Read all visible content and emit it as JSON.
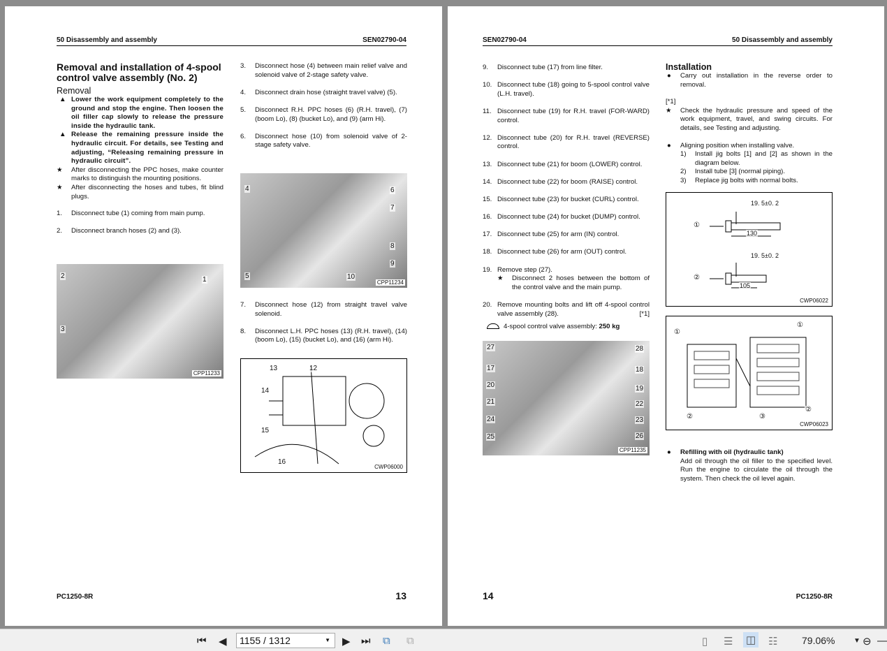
{
  "left_page": {
    "header_left": "50 Disassembly and assembly",
    "header_right": "SEN02790-04",
    "title": "Removal and installation of 4-spool control valve assembly (No. 2)",
    "section": "Removal",
    "warnings": [
      "Lower the work equipment completely to the ground and stop the engine. Then loosen the oil filler cap slowly to release the pressure inside the hydraulic tank.",
      "Release the remaining pressure inside the hydraulic circuit. For details, see Testing and adjusting, “Releasing remaining pressure in hydraulic circuit”."
    ],
    "notes": [
      "After disconnecting the PPC hoses, make counter marks to distinguish the mounting positions.",
      "After disconnecting the hoses and tubes, fit blind plugs."
    ],
    "steps": [
      {
        "n": "1.",
        "text": "Disconnect tube (1) coming from main pump."
      },
      {
        "n": "2.",
        "text": "Disconnect branch hoses (2) and (3)."
      },
      {
        "n": "3.",
        "text": "Disconnect hose (4) between main relief valve and solenoid valve of 2-stage safety valve."
      },
      {
        "n": "4.",
        "text": "Disconnect drain hose (straight travel valve) (5)."
      },
      {
        "n": "5.",
        "text": "Disconnect R.H. PPC hoses (6) (R.H. travel), (7) (boom Lo), (8) (bucket Lo), and (9) (arm Hi)."
      },
      {
        "n": "6.",
        "text": "Disconnect hose (10) from solenoid valve of 2-stage safety valve."
      },
      {
        "n": "7.",
        "text": "Disconnect hose (12) from straight travel valve solenoid."
      },
      {
        "n": "8.",
        "text": "Disconnect L.H. PPC hoses (13) (R.H. travel), (14) (boom Lo), (15) (bucket Lo), and (16) (arm Hi)."
      }
    ],
    "figures": [
      {
        "code": "CPP11233",
        "labels": [
          "2",
          "1",
          "3"
        ]
      },
      {
        "code": "CPP11234",
        "labels": [
          "4",
          "6",
          "7",
          "8",
          "9",
          "5",
          "10"
        ]
      },
      {
        "code": "CWP06000",
        "labels": [
          "13",
          "12",
          "14",
          "15",
          "16"
        ]
      }
    ],
    "footer_left": "PC1250-8R",
    "page_number": "13"
  },
  "right_page": {
    "header_left": "SEN02790-04",
    "header_right": "50 Disassembly and assembly",
    "steps": [
      {
        "n": "9.",
        "text": "Disconnect tube (17) from line filter."
      },
      {
        "n": "10.",
        "text": "Disconnect tube (18) going to 5-spool control valve (L.H. travel)."
      },
      {
        "n": "11.",
        "text": "Disconnect tube (19) for R.H. travel (FOR-WARD) control."
      },
      {
        "n": "12.",
        "text": "Disconnect tube (20) for R.H. travel (REVERSE) control."
      },
      {
        "n": "13.",
        "text": "Disconnect tube (21) for boom (LOWER) control."
      },
      {
        "n": "14.",
        "text": "Disconnect tube (22) for boom (RAISE) control."
      },
      {
        "n": "15.",
        "text": "Disconnect tube (23) for bucket (CURL) control."
      },
      {
        "n": "16.",
        "text": "Disconnect tube (24) for bucket (DUMP) control."
      },
      {
        "n": "17.",
        "text": "Disconnect tube (25) for arm (IN) control."
      },
      {
        "n": "18.",
        "text": "Disconnect tube (26) for arm (OUT) control."
      },
      {
        "n": "19.",
        "text": "Remove step (27).",
        "note": "Disconnect 2 hoses between the bottom of the control valve and the main pump."
      },
      {
        "n": "20.",
        "text": "Remove mounting bolts and lift off 4-spool control valve assembly (28).",
        "ref": "[*1]"
      }
    ],
    "weight_label": "4-spool control valve assembly:",
    "weight_value": "250 kg",
    "installation": {
      "title": "Installation",
      "bullet1": "Carry out installation in the reverse order to removal.",
      "ref": "[*1]",
      "note": "Check the hydraulic pressure and speed of the work equipment, travel, and swing circuits. For details, see Testing and adjusting.",
      "bullet2": "Aligning position when installing valve.",
      "substeps": [
        {
          "n": "1)",
          "text": "Install jig bolts [1] and [2] as shown in the diagram below."
        },
        {
          "n": "2)",
          "text": "Install tube [3] (normal piping)."
        },
        {
          "n": "3)",
          "text": "Replace jig bolts with normal bolts."
        }
      ],
      "refill_title": "Refilling with oil (hydraulic tank)",
      "refill_text": "Add oil through the oil filler to the specified level. Run the engine to circulate the oil through the system. Then check the oil level again."
    },
    "figures": [
      {
        "code": "CPP11235",
        "labels": [
          "27",
          "28",
          "17",
          "18",
          "20",
          "19",
          "21",
          "22",
          "24",
          "23",
          "25",
          "26"
        ]
      },
      {
        "code": "CWP06022",
        "labels": [
          "①",
          "②",
          "19. 5±0. 2",
          "130",
          "19. 5±0. 2",
          "105"
        ]
      },
      {
        "code": "CWP06023",
        "labels": [
          "①",
          "①",
          "②",
          "②",
          "②",
          "③"
        ]
      }
    ],
    "footer_left": "PC1250-8R",
    "page_number": "14"
  },
  "toolbar": {
    "page_value": "1155 / 1312",
    "zoom": "79.06%"
  }
}
